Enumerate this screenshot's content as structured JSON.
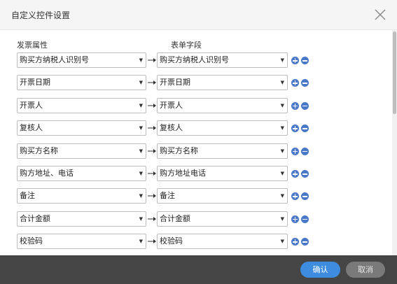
{
  "dialog": {
    "title": "自定义控件设置"
  },
  "columns": {
    "left_header": "发票属性",
    "right_header": "表单字段"
  },
  "rows": [
    {
      "invoice_attr": "购买方纳税人识别号",
      "form_field": "购买方纳税人识别号"
    },
    {
      "invoice_attr": "开票日期",
      "form_field": "开票日期"
    },
    {
      "invoice_attr": "开票人",
      "form_field": "开票人"
    },
    {
      "invoice_attr": "复核人",
      "form_field": "复核人"
    },
    {
      "invoice_attr": "购买方名称",
      "form_field": "购买方名称"
    },
    {
      "invoice_attr": "购方地址、电话",
      "form_field": "购方地址电话"
    },
    {
      "invoice_attr": "备注",
      "form_field": "备注"
    },
    {
      "invoice_attr": "合计金额",
      "form_field": "合计金额"
    },
    {
      "invoice_attr": "校验码",
      "form_field": "校验码"
    }
  ],
  "footer": {
    "confirm_label": "确认",
    "cancel_label": "取消"
  },
  "colors": {
    "accent": "#3d8ce0",
    "icon_blue": "#4a78c9",
    "footer_bg": "#454545"
  },
  "icons": {
    "close": "close-icon",
    "add": "plus-circle-icon",
    "remove": "minus-circle-icon",
    "arrow": "arrow-right-icon",
    "caret": "caret-down-icon"
  }
}
